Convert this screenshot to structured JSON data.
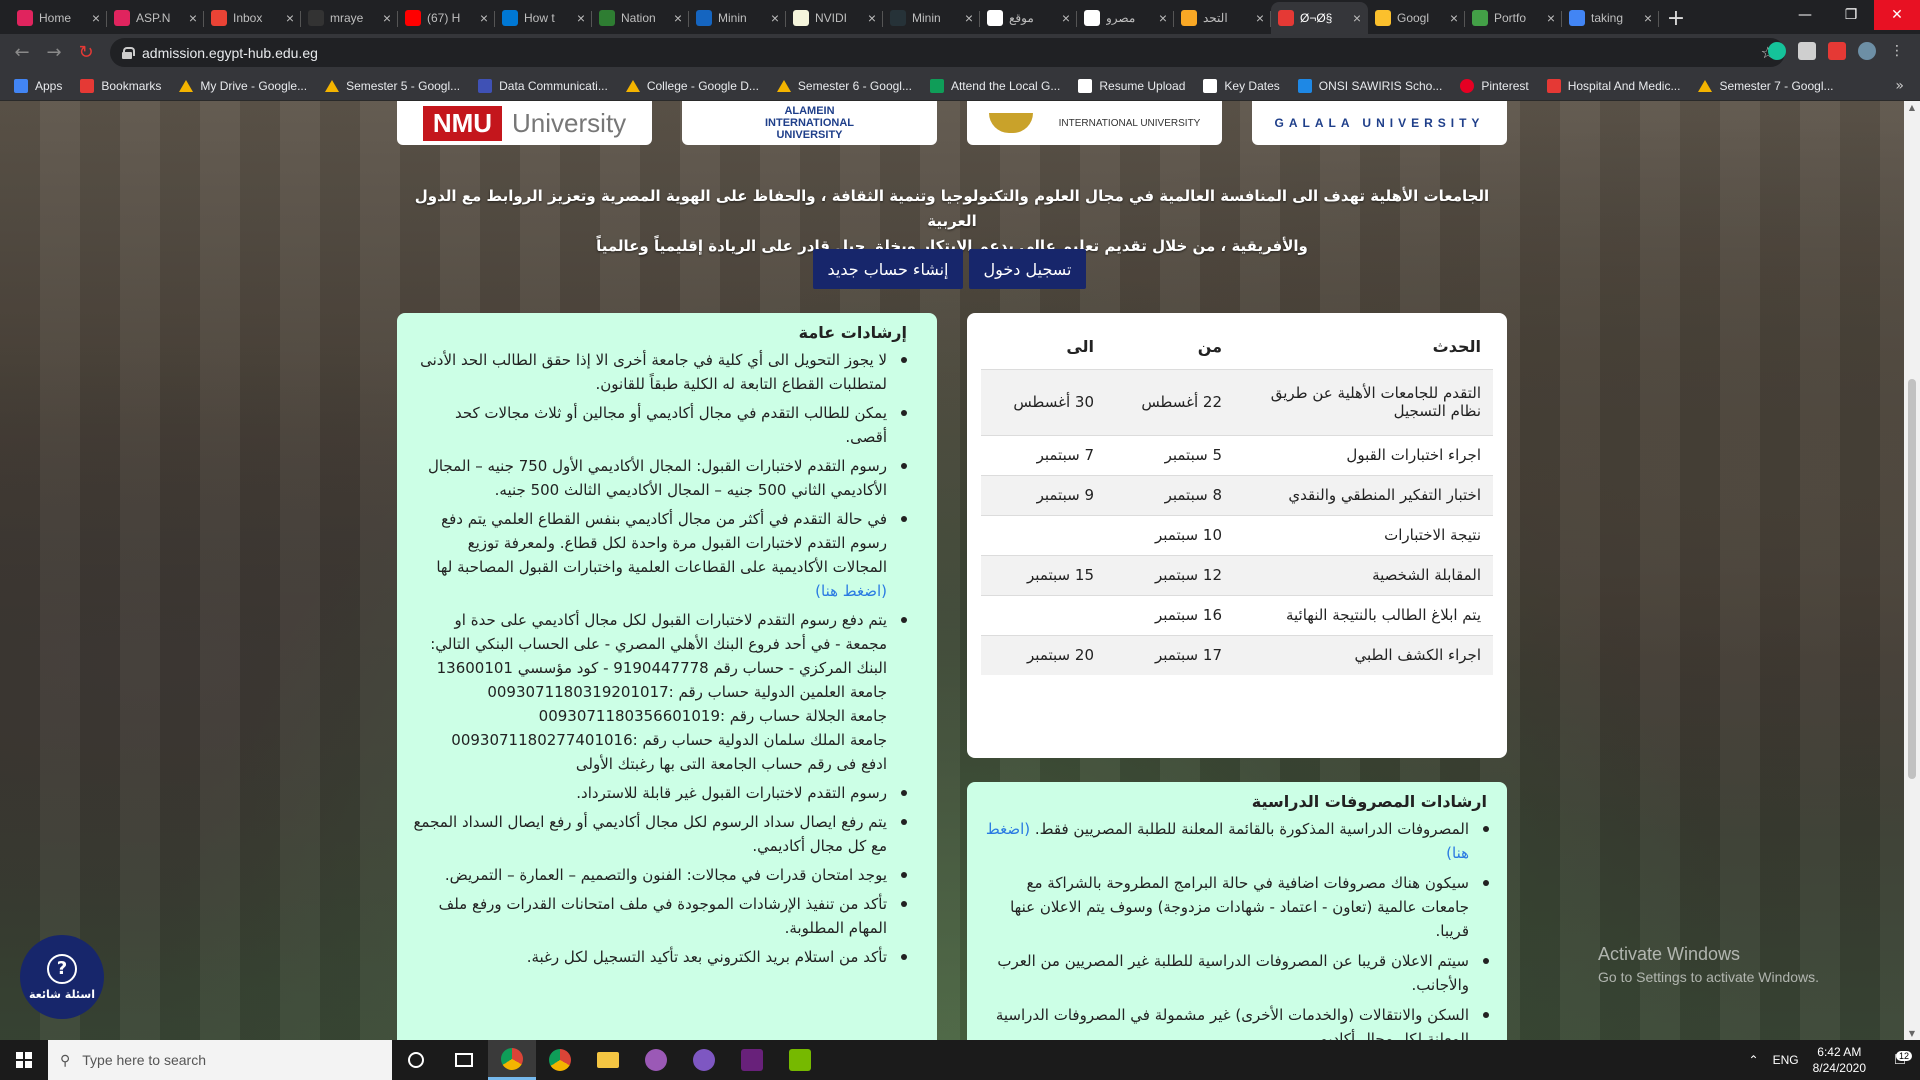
{
  "browser": {
    "tabs": [
      {
        "label": "Home",
        "color": "#e0245e",
        "active": false
      },
      {
        "label": "ASP.N",
        "color": "#e0245e",
        "active": false
      },
      {
        "label": "Inbox",
        "color": "#ea4335",
        "active": false
      },
      {
        "label": "mraye",
        "color": "#333333",
        "active": false
      },
      {
        "label": "(67) H",
        "color": "#ff0000",
        "active": false
      },
      {
        "label": "How t",
        "color": "#0078d4",
        "active": false
      },
      {
        "label": "Nation",
        "color": "#2e7d32",
        "active": false
      },
      {
        "label": "Minin",
        "color": "#1565c0",
        "active": false
      },
      {
        "label": "NVIDI",
        "color": "#f5f5dc",
        "active": false
      },
      {
        "label": "Minin",
        "color": "#263238",
        "active": false
      },
      {
        "label": "موقع",
        "color": "#ffffff",
        "active": false
      },
      {
        "label": "مصرو",
        "color": "#ffffff",
        "active": false
      },
      {
        "label": "التحد",
        "color": "#f9a825",
        "active": false
      },
      {
        "label": "Ø¬Ø§",
        "color": "#e53935",
        "active": true
      },
      {
        "label": "Googl",
        "color": "#fbc02d",
        "active": false
      },
      {
        "label": "Portfo",
        "color": "#43a047",
        "active": false
      },
      {
        "label": "taking",
        "color": "#4285f4",
        "active": false
      }
    ],
    "url": "admission.egypt-hub.edu.eg",
    "bookmarks": [
      {
        "label": "Apps",
        "icon": "apps-grid-icon"
      },
      {
        "label": "Bookmarks",
        "icon": "bookmark-icon"
      },
      {
        "label": "My Drive - Google...",
        "icon": "google-drive-icon"
      },
      {
        "label": "Semester 5 - Googl...",
        "icon": "google-drive-icon"
      },
      {
        "label": "Data Communicati...",
        "icon": "tp-icon"
      },
      {
        "label": "College - Google D...",
        "icon": "google-drive-icon"
      },
      {
        "label": "Semester 6 - Googl...",
        "icon": "google-drive-icon"
      },
      {
        "label": "Attend the Local G...",
        "icon": "calendar-icon"
      },
      {
        "label": "Resume Upload",
        "icon": "doc-icon"
      },
      {
        "label": "Key Dates",
        "icon": "doc-icon"
      },
      {
        "label": "ONSI SAWIRIS Scho...",
        "icon": "school-icon"
      },
      {
        "label": "Pinterest",
        "icon": "pinterest-icon"
      },
      {
        "label": "Hospital And Medic...",
        "icon": "link-icon"
      },
      {
        "label": "Semester 7 - Googl...",
        "icon": "google-drive-icon"
      }
    ],
    "bookmarks_more": "»"
  },
  "page": {
    "logos": {
      "logo1_red": "NMU",
      "logo1_gray": "University",
      "logo2_line1": "ALAMEIN",
      "logo2_line2": "INTERNATIONAL",
      "logo2_line3": "UNIVERSITY",
      "logo3": "INTERNATIONAL UNIVERSITY",
      "logo4": "GALALA UNIVERSITY"
    },
    "intro_line1": "الجامعات الأهلية تهدف الى المنافسة العالمية في مجال العلوم والتكنولوجيا وتنمية الثقافة ، والحفاظ على الهوية المصرية وتعزيز الروابط مع الدول العربية",
    "intro_line2": "والأفريقية ، من خلال تقديم تعليم عالي يدعم الابتكار ويخلق جيل قادر على الريادة إقليمياً وعالمياً",
    "buttons": {
      "login": "تسجيل دخول",
      "register": "إنشاء حساب جديد"
    },
    "schedule": {
      "headers": {
        "event": "الحدث",
        "from": "من",
        "to": "الى"
      },
      "rows": [
        {
          "event": "التقدم للجامعات الأهلية عن طريق نظام التسجيل",
          "from": "22 أغسطس",
          "to": "30 أغسطس"
        },
        {
          "event": "اجراء اختبارات القبول",
          "from": "5 سبتمبر",
          "to": "7 سبتمبر"
        },
        {
          "event": "اختبار التفكير المنطقي والنقدي",
          "from": "8 سبتمبر",
          "to": "9 سبتمبر"
        },
        {
          "event": "نتيجة الاختبارات",
          "from": "10 سبتمبر",
          "to": ""
        },
        {
          "event": "المقابلة الشخصية",
          "from": "12 سبتمبر",
          "to": "15 سبتمبر"
        },
        {
          "event": "يتم ابلاغ الطالب بالنتيجة النهائية",
          "from": "16 سبتمبر",
          "to": ""
        },
        {
          "event": "اجراء الكشف الطبي",
          "from": "17 سبتمبر",
          "to": "20 سبتمبر"
        }
      ]
    },
    "guidelines": {
      "title": "إرشادات عامة",
      "items": [
        "لا يجوز التحويل الى أي كلية في جامعة أخرى الا إذا حقق الطالب الحد الأدنى لمتطلبات القطاع التابعة له الكلية طبقاً للقانون.",
        "يمكن للطالب التقدم في مجال أكاديمي أو مجالين أو ثلاث مجالات كحد أقصى.",
        "رسوم التقدم لاختبارات القبول: المجال الأكاديمي الأول 750 جنيه – المجال الأكاديمي الثاني 500 جنيه – المجال الأكاديمي الثالث 500 جنيه."
      ],
      "item4_text": "في حالة التقدم في أكثر من مجال أكاديمي بنفس القطاع العلمي يتم دفع رسوم التقدم لاختبارات القبول مرة واحدة لكل قطاع. ولمعرفة توزيع المجالات الأكاديمية على القطاعات العلمية واختبارات القبول المصاحبة لها",
      "item4_link": "(اضغط هنا)",
      "item5_text": "يتم دفع رسوم التقدم لاختبارات القبول لكل مجال أكاديمي على حدة او مجمعة - في أحد فروع البنك الأهلي المصري - على الحساب البنكي التالي: البنك المركزي - حساب رقم 9190447778 - كود مؤسسي 13600101",
      "item5_lines": [
        "جامعة العلمين الدولية حساب رقم :0093071180319201017",
        "جامعة الجلالة حساب رقم :0093071180356601019",
        "جامعة الملك سلمان الدولية حساب رقم :0093071180277401016",
        "ادفع فى رقم حساب الجامعة التى بها رغبتك الأولى"
      ],
      "items_after": [
        "رسوم التقدم لاختبارات القبول غير قابلة للاسترداد.",
        "يتم رفع ايصال سداد الرسوم لكل مجال أكاديمي أو رفع ايصال السداد المجمع مع كل مجال أكاديمي.",
        "يوجد امتحان قدرات في مجالات: الفنون والتصميم – العمارة – التمريض.",
        "تأكد من تنفيذ الإرشادات الموجودة في ملف امتحانات القدرات ورفع ملف المهام المطلوبة.",
        "تأكد من استلام بريد الكتروني بعد تأكيد التسجيل لكل رغبة."
      ]
    },
    "tuition": {
      "title": "ارشادات المصروفات الدراسية",
      "item1_text": "المصروفات الدراسية المذكورة بالقائمة المعلنة للطلبة المصريين فقط.",
      "item1_link": "(اضغط هنا)",
      "items": [
        "سيكون هناك مصروفات اضافية في حالة البرامج المطروحة بالشراكة مع جامعات عالمية (تعاون - اعتماد - شهادات مزدوجة) وسوف يتم الاعلان عنها قريبا.",
        "سيتم الاعلان قريبا عن المصروفات الدراسية للطلبة غير المصريين من العرب والأجانب.",
        "السكن والانتقالات (والخدمات الأخرى) غير مشمولة في المصروفات الدراسية المعلنة لكل مجال أكاديمي"
      ]
    },
    "faq_label": "اسئلة شائعة",
    "faq_icon": "?",
    "activate_title": "Activate Windows",
    "activate_sub": "Go to Settings to activate Windows."
  },
  "taskbar": {
    "search_placeholder": "Type here to search",
    "lang": "ENG",
    "time": "6:42 AM",
    "date": "8/24/2020",
    "notification_count": "12"
  }
}
